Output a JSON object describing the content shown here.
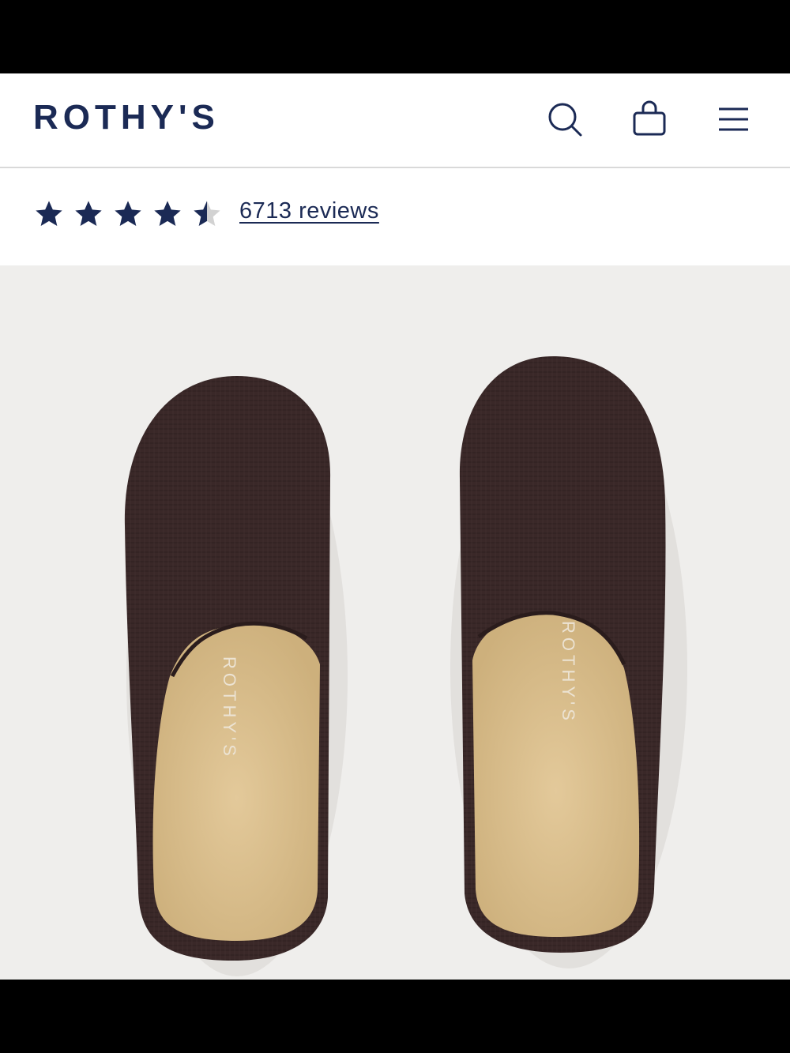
{
  "header": {
    "logo_text": "ROTHY'S",
    "icons": [
      "search-icon",
      "shopping-bag-icon",
      "menu-icon"
    ]
  },
  "rating": {
    "value": 4.5,
    "max": 5,
    "reviews_label": "6713 reviews"
  },
  "product_image": {
    "insole_brand_text": "ROTHY'S"
  },
  "colors": {
    "brand_navy": "#1b2a55",
    "image_background": "#efeeec",
    "upper_knit": "#3a2828",
    "footbed": "#d8bd8c"
  }
}
